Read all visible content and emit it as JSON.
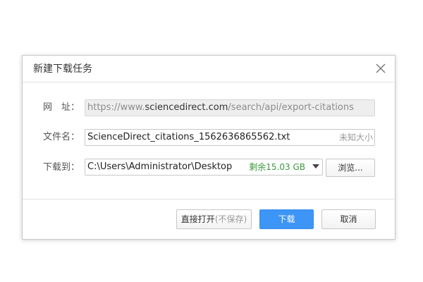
{
  "dialog": {
    "title": "新建下载任务",
    "close_icon": "close-icon"
  },
  "url_row": {
    "label": "网　址：",
    "value_prefix": "https://www.",
    "value_host": "sciencedirect.com",
    "value_suffix": "/search/api/export-citations"
  },
  "filename_row": {
    "label": "文件名：",
    "value": "ScienceDirect_citations_1562636865562.txt",
    "size_hint": "未知大小"
  },
  "saveto_row": {
    "label": "下载到：",
    "path": "C:\\Users\\Administrator\\Desktop",
    "free_space": "剩余15.03 GB",
    "dropdown_icon": "chevron-down-icon",
    "browse_label": "浏览..."
  },
  "footer": {
    "open_label": "直接打开",
    "open_sub": "(不保存)",
    "download_label": "下载",
    "cancel_label": "取消"
  },
  "colors": {
    "primary": "#3d95f5",
    "free_space": "#3a9a3a"
  }
}
